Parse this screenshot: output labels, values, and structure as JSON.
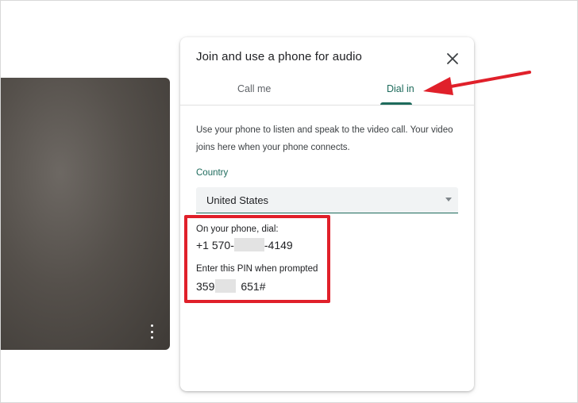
{
  "dialog": {
    "title": "Join and use a phone for audio",
    "tabs": [
      {
        "label": "Call me",
        "selected": false
      },
      {
        "label": "Dial in",
        "selected": true
      }
    ],
    "description": "Use your phone to listen and speak to the video call. Your video joins here when your phone connects.",
    "country_label": "Country",
    "country_value": "United States",
    "phone_label": "On your phone, dial:",
    "phone_prefix": "+1 570-",
    "phone_suffix": "-4149",
    "pin_label": "Enter this PIN when prompted",
    "pin_prefix": "359",
    "pin_suffix": "651#"
  },
  "icons": {
    "close": "close-icon",
    "dropdown": "chevron-down-icon",
    "more": "more-vert-icon"
  },
  "colors": {
    "accent": "#1e6b5c",
    "annotation": "#e0202a",
    "video_bg": "#55504b"
  }
}
